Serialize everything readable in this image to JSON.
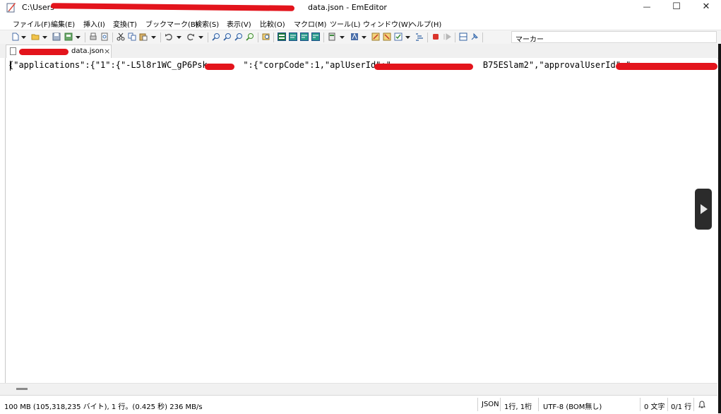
{
  "window": {
    "title_visible_start": "C:\\Users",
    "title_visible_end": "data.json - EmEditor",
    "minimize_glyph": "—",
    "maximize_glyph": "☐",
    "close_glyph": "✕"
  },
  "menu": {
    "items": [
      "ファイル(F)",
      "編集(E)",
      "挿入(I)",
      "変換(T)",
      "ブックマーク(B)",
      "検索(S)",
      "表示(V)",
      "比較(O)",
      "マクロ(M)",
      "ツール(L)",
      "ウィンドウ(W)",
      "ヘルプ(H)"
    ]
  },
  "toolbar": {
    "marker_label": "マーカー"
  },
  "tab": {
    "visible_name": "data.json",
    "close_glyph": "×"
  },
  "editor": {
    "line_1_visible": "{\"applications\":{\"1\":{\"-L5l8r1WC_gP6Psk       \":{\"corpCode\":1,\"aplUserId\":\"                  B75ESlam2\",\"approvalUserId\":\""
  },
  "status": {
    "summary": "100 MB (105,318,235 バイト), 1 行。(0.425 秒) 236 MB/s",
    "language": "JSON",
    "position": "1行, 1桁",
    "encoding": "UTF-8 (BOM無し)",
    "char_count": "0 文字",
    "line_count": "0/1 行"
  },
  "colors": {
    "redaction": "#e3141c",
    "toolbar_bg": "#f4f4f4",
    "editor_bg": "#ffffff"
  }
}
